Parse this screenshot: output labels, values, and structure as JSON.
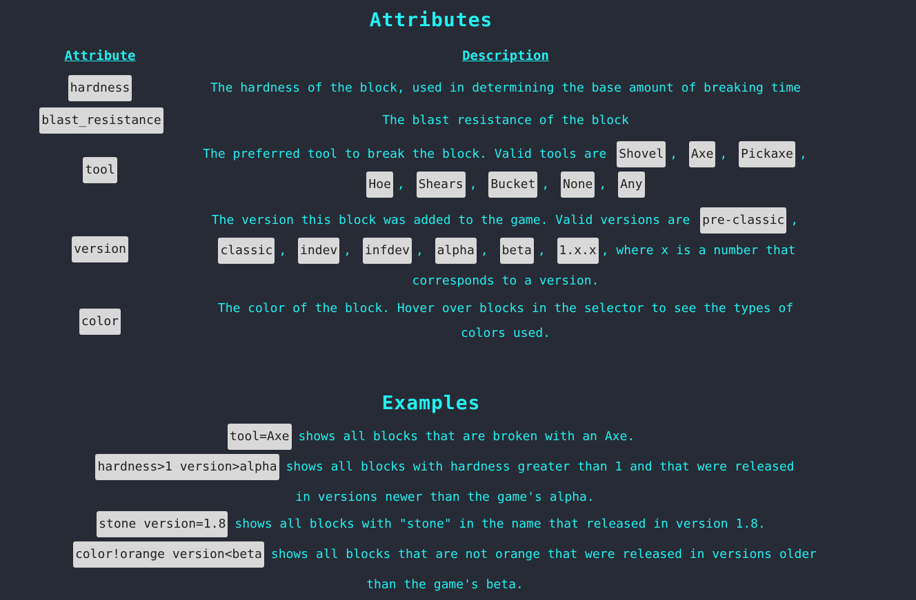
{
  "attributes_section": {
    "title": "Attributes",
    "col_attribute": "Attribute",
    "col_description": "Description",
    "rows": [
      {
        "attribute": "hardness",
        "description": "The hardness of the block, used in determining the base amount of breaking time"
      },
      {
        "attribute": "blast_resistance",
        "description": "The blast resistance of the block"
      },
      {
        "attribute": "tool",
        "description_prefix": "The preferred tool to break the block. Valid tools are",
        "tools": [
          "Shovel",
          "Axe",
          "Pickaxe",
          "Hoe",
          "Shears",
          "Bucket",
          "None",
          "Any"
        ]
      },
      {
        "attribute": "version",
        "description_prefix": "The version this block was added to the game. Valid versions are",
        "versions": [
          "pre-classic",
          "classic",
          "indev",
          "infdev",
          "alpha",
          "beta",
          "1.x.x"
        ],
        "description_suffix": ", where x is a number that corresponds to a version."
      },
      {
        "attribute": "color",
        "description": "The color of the block. Hover over blocks in the selector to see the types of colors used."
      }
    ],
    "separator": ","
  },
  "examples_section": {
    "title": "Examples",
    "items": [
      {
        "query": "tool=Axe",
        "text": "shows all blocks that are broken with an Axe."
      },
      {
        "query": "hardness>1 version>alpha",
        "text": "shows all blocks with hardness greater than 1 and that were released in versions newer than the game's alpha."
      },
      {
        "query": "stone version=1.8",
        "text": "shows all blocks with \"stone\" in the name that released in version 1.8."
      },
      {
        "query": "color!orange version<beta",
        "text": "shows all blocks that are not orange that were released in versions older than the game's beta."
      }
    ]
  }
}
